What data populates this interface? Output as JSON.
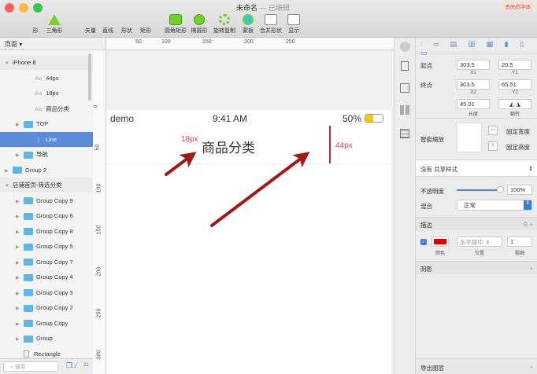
{
  "window": {
    "title": "未命名",
    "status": "— 已编辑",
    "badge": "丢失的字体"
  },
  "toolbar": {
    "items": [
      "形",
      "三角形",
      "矢量",
      "直线",
      "形状",
      "矩形",
      "圆角矩形",
      "椭圆形",
      "旋转复制",
      "蒙板",
      "合并形状",
      "显示"
    ]
  },
  "page_selector": "页面",
  "hruler": [
    "50",
    "100",
    "150",
    "200",
    "250"
  ],
  "vruler": [
    "0",
    "50",
    "100",
    "150",
    "200",
    "250",
    "300"
  ],
  "layers": [
    {
      "name": "iPhone 8",
      "type": "artboard",
      "level": 0
    },
    {
      "name": "44px",
      "type": "text",
      "level": 2
    },
    {
      "name": "18px",
      "type": "text",
      "level": 2
    },
    {
      "name": "商品分类",
      "type": "text",
      "level": 2
    },
    {
      "name": "TOP",
      "type": "group",
      "level": 1
    },
    {
      "name": "Line",
      "type": "line",
      "level": 2,
      "selected": true
    },
    {
      "name": "导航",
      "type": "group",
      "level": 1
    },
    {
      "name": "Group 2",
      "type": "group",
      "level": 0
    },
    {
      "name": "店铺首页-筛选分类",
      "type": "artboard",
      "level": 0
    },
    {
      "name": "Group Copy 9",
      "type": "group",
      "level": 1
    },
    {
      "name": "Group Copy 6",
      "type": "group",
      "level": 1
    },
    {
      "name": "Group Copy 8",
      "type": "group",
      "level": 1
    },
    {
      "name": "Group Copy 5",
      "type": "group",
      "level": 1
    },
    {
      "name": "Group Copy 7",
      "type": "group",
      "level": 1
    },
    {
      "name": "Group Copy 4",
      "type": "group",
      "level": 1
    },
    {
      "name": "Group Copy 3",
      "type": "group",
      "level": 1
    },
    {
      "name": "Group Copy 2",
      "type": "group",
      "level": 1
    },
    {
      "name": "Group Copy",
      "type": "group",
      "level": 1
    },
    {
      "name": "Group",
      "type": "group",
      "level": 1
    },
    {
      "name": "Rectangle",
      "type": "rect",
      "level": 1
    }
  ],
  "search": {
    "placeholder": "搜索",
    "count": "21"
  },
  "artboard": {
    "carrier": "demo",
    "time": "9:41 AM",
    "battery": "50%",
    "nav_title": "商品分类",
    "label_18": "18px",
    "label_44": "44px"
  },
  "inspector": {
    "start_label": "起点",
    "end_label": "终点",
    "x1": "303.5",
    "y1": "20.5",
    "x2": "303.5",
    "y2": "65.51",
    "length": "45.01",
    "x1_label": "X1",
    "y1_label": "Y1",
    "x2_label": "X2",
    "y2_label": "Y2",
    "length_label": "长度",
    "flip_label": "翻转",
    "resizing_label": "智能缩放",
    "fix_width": "固定宽度",
    "fix_height": "固定高度",
    "shared_style": "没有 共享样式",
    "opacity_label": "不透明度",
    "opacity": "100%",
    "opacity_value": 1.0,
    "blend_label": "混合",
    "blend": "正常",
    "border_label": "描边",
    "border_color": "#e00000",
    "border_position": "水平居中",
    "border_width": "1",
    "color_label": "颜色",
    "position_label": "位置",
    "thickness_label": "粗细",
    "shadow_label": "阴影",
    "export_label": "导出图层"
  }
}
